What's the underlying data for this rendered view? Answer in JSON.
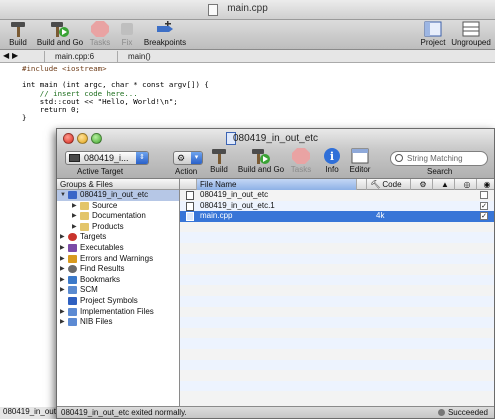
{
  "back_window": {
    "title": "main.cpp",
    "toolbar": {
      "build": "Build",
      "build_and_go": "Build and Go",
      "tasks": "Tasks",
      "fix": "Fix",
      "breakpoints": "Breakpoints",
      "project": "Project",
      "ungrouped": "Ungrouped"
    },
    "navbar": {
      "file": "main.cpp:6",
      "function": "main()"
    },
    "code_lines": [
      "#include <iostream>",
      "",
      "int main (int argc, char * const argv[]) {",
      "    // insert code here...",
      "    std::cout << \"Hello, World!\\n\";",
      "    return 0;",
      "}"
    ],
    "status_text": "080419_in_out"
  },
  "front_window": {
    "title": "080419_in_out_etc",
    "toolbar": {
      "active_target_value": "080419_i...",
      "active_target_label": "Active Target",
      "action_label": "Action",
      "build": "Build",
      "build_and_go": "Build and Go",
      "tasks": "Tasks",
      "info": "Info",
      "editor": "Editor",
      "search_placeholder": "String Matching",
      "search_label": "Search"
    },
    "groups": {
      "header": "Groups & Files",
      "items": [
        {
          "label": "080419_in_out_etc",
          "level": 0,
          "tri": "▼",
          "color": "#3a66c8"
        },
        {
          "label": "Source",
          "level": 1,
          "tri": "▶",
          "color": "#e3c56a"
        },
        {
          "label": "Documentation",
          "level": 1,
          "tri": "▶",
          "color": "#e3c56a"
        },
        {
          "label": "Products",
          "level": 1,
          "tri": "▶",
          "color": "#e3c56a"
        },
        {
          "label": "Targets",
          "level": 0,
          "tri": "▶",
          "color": "#c9342c"
        },
        {
          "label": "Executables",
          "level": 0,
          "tri": "▶",
          "color": "#7b4aa6"
        },
        {
          "label": "Errors and Warnings",
          "level": 0,
          "tri": "▶",
          "color": "#d89a1e"
        },
        {
          "label": "Find Results",
          "level": 0,
          "tri": "▶",
          "color": "#6a6a6a"
        },
        {
          "label": "Bookmarks",
          "level": 0,
          "tri": "▶",
          "color": "#3b79c9"
        },
        {
          "label": "SCM",
          "level": 0,
          "tri": "▶",
          "color": "#5a8ad0"
        },
        {
          "label": "Project Symbols",
          "level": 0,
          "tri": "",
          "color": "#2e5fc0"
        },
        {
          "label": "Implementation Files",
          "level": 0,
          "tri": "▶",
          "color": "#5c8ad3"
        },
        {
          "label": "NIB Files",
          "level": 0,
          "tri": "▶",
          "color": "#5c8ad3"
        }
      ]
    },
    "files": {
      "columns": {
        "file_name": "File Name",
        "code": "Code"
      },
      "rows": [
        {
          "name": "080419_in_out_etc",
          "code": "",
          "checked": false
        },
        {
          "name": "080419_in_out_etc.1",
          "code": "",
          "checked": true
        },
        {
          "name": "main.cpp",
          "code": "4k",
          "checked": true
        }
      ]
    },
    "status": {
      "message": "080419_in_out_etc exited normally.",
      "result": "Succeeded"
    }
  }
}
